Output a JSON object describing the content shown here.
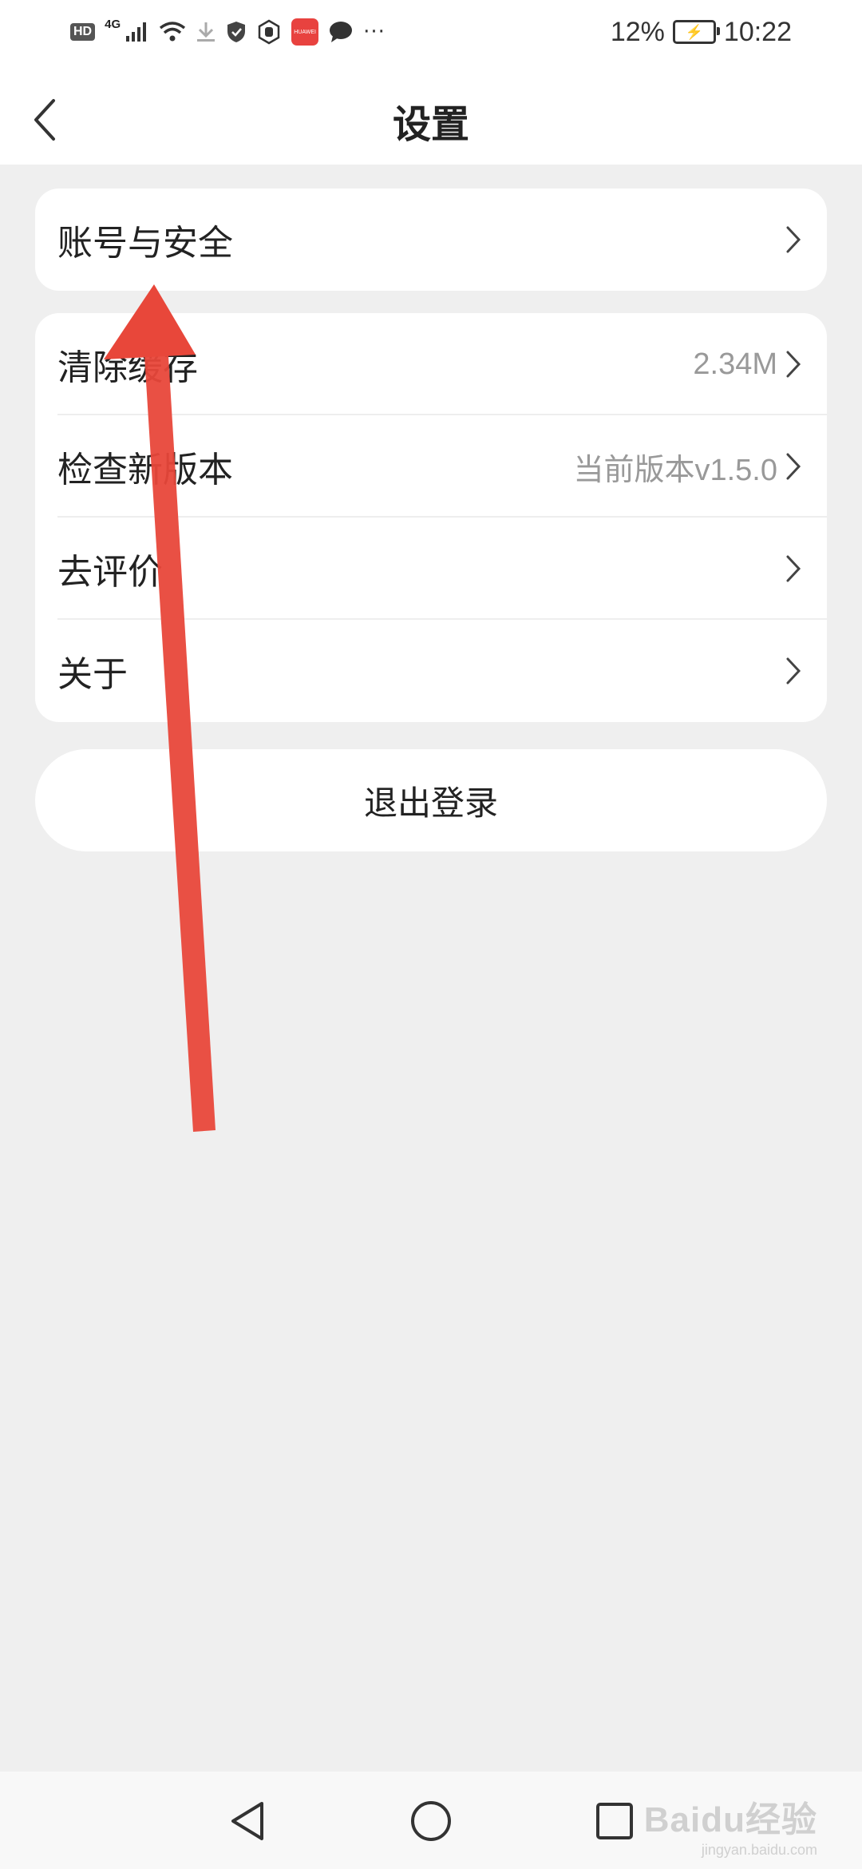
{
  "status_bar": {
    "left_icons": [
      "hd-badge",
      "4g-signal-icon",
      "wifi-icon",
      "download-icon",
      "shield-icon",
      "hand-icon",
      "huawei-app-icon",
      "message-icon",
      "more-dots-icon"
    ],
    "hd_label": "HD",
    "network_label": "4G",
    "app_badge_label": "HUAWEI",
    "more": "···",
    "battery": "12%",
    "time": "10:22"
  },
  "header": {
    "title": "设置"
  },
  "sections": {
    "account": {
      "label": "账号与安全"
    },
    "clear_cache": {
      "label": "清除缓存",
      "value": "2.34M"
    },
    "check_update": {
      "label": "检查新版本",
      "value": "当前版本v1.5.0"
    },
    "rate": {
      "label": "去评价"
    },
    "about": {
      "label": "关于"
    }
  },
  "logout_label": "退出登录",
  "annotation": {
    "arrow_color": "#e8473a"
  },
  "nav": {
    "back": "back-triangle-icon",
    "home": "home-circle-icon",
    "recent": "recent-square-icon"
  },
  "watermark": {
    "line1": "Baidu经验",
    "line2": "jingyan.baidu.com"
  }
}
